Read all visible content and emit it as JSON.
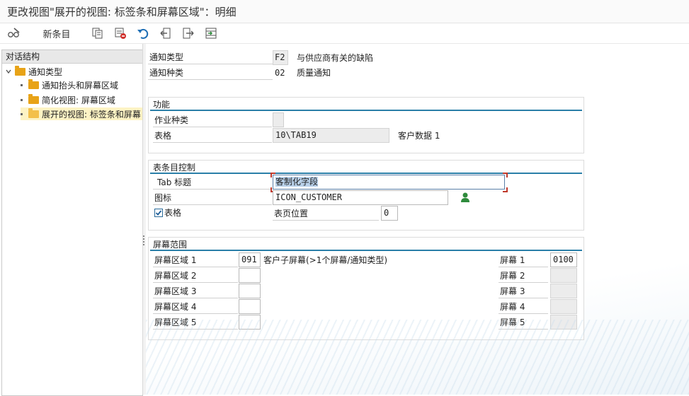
{
  "window": {
    "title": "更改视图\"展开的视图: 标签条和屏幕区域\"：明细"
  },
  "toolbar": {
    "new_entries": "新条目"
  },
  "tree": {
    "header": "对话结构",
    "root": "通知类型",
    "items": [
      "通知抬头和屏幕区域",
      "简化视图: 屏幕区域",
      "展开的视图: 标签条和屏幕"
    ]
  },
  "keys": {
    "notif_type_label": "通知类型",
    "notif_type_value": "F2",
    "notif_type_desc": "与供应商有关的缺陷",
    "notif_cat_label": "通知种类",
    "notif_cat_value": "02",
    "notif_cat_desc": "质量通知"
  },
  "function_group": {
    "title": "功能",
    "activity_type_label": "作业种类",
    "activity_type_value": "",
    "table_label": "表格",
    "table_value": "10\\TAB19",
    "table_desc": "客户数据 1"
  },
  "tab_control": {
    "title": "表条目控制",
    "tab_title_label": "Tab 标题",
    "tab_title_value": "客制化字段",
    "icon_label": "图标",
    "icon_value": "ICON_CUSTOMER",
    "table_checkbox_label": "表格",
    "table_checked": true,
    "tab_pos_label": "表页位置",
    "tab_pos_value": "0"
  },
  "screen_range": {
    "title": "屏幕范围",
    "areas": [
      {
        "label": "屏幕区域 1",
        "value": "091",
        "desc": "客户子屏幕(>1个屏幕/通知类型)",
        "screen_label": "屏幕 1",
        "screen_value": "0100"
      },
      {
        "label": "屏幕区域 2",
        "value": "",
        "desc": "",
        "screen_label": "屏幕 2",
        "screen_value": ""
      },
      {
        "label": "屏幕区域 3",
        "value": "",
        "desc": "",
        "screen_label": "屏幕 3",
        "screen_value": ""
      },
      {
        "label": "屏幕区域 4",
        "value": "",
        "desc": "",
        "screen_label": "屏幕 4",
        "screen_value": ""
      },
      {
        "label": "屏幕区域 5",
        "value": "",
        "desc": "",
        "screen_label": "屏幕 5",
        "screen_value": ""
      }
    ]
  },
  "colors": {
    "accent": "#2a7fa8",
    "folder": "#e8a317",
    "person_icon": "#2e8b3c"
  }
}
